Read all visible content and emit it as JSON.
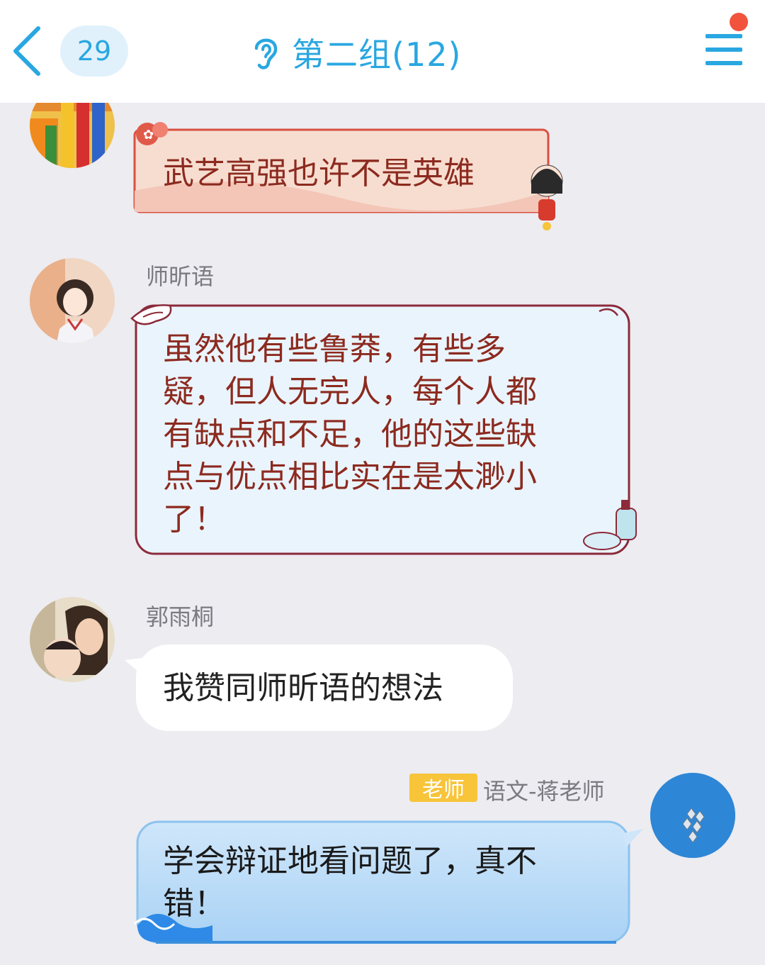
{
  "header": {
    "unread_count": "29",
    "title": "第二组(12)",
    "icons": {
      "back": "chevron-left-icon",
      "earpiece": "ear-icon",
      "menu": "hamburger-menu-icon"
    },
    "accent_color": "#29a7e1",
    "notification_dot_color": "#f2533d"
  },
  "messages": [
    {
      "sender": "",
      "text": "武艺高强也许不是英雄",
      "bubble_style": "red-festive"
    },
    {
      "sender": "师昕语",
      "text_lines": [
        "虽然他有些鲁莽，有些多",
        "疑，但人无完人，每个人都",
        "有缺点和不足，他的这些缺",
        "点与优点相比实在是太渺小",
        "了！"
      ],
      "bubble_style": "light-blue-cartoon"
    },
    {
      "sender": "郭雨桐",
      "text": "我赞同师昕语的想法",
      "bubble_style": "plain-white"
    },
    {
      "sender": "语文-蒋老师",
      "role_tag": "老师",
      "text_lines": [
        "学会辩证地看问题了，真不",
        "错！"
      ],
      "bubble_style": "blue-wave",
      "outgoing_side": "right"
    }
  ]
}
